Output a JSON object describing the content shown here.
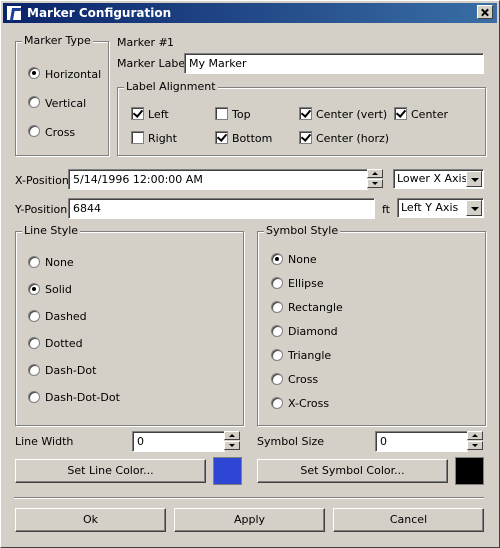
{
  "window": {
    "title": "Marker Configuration"
  },
  "marker_type": {
    "legend": "Marker Type",
    "options": [
      "Horizontal",
      "Vertical",
      "Cross"
    ],
    "selected": "Horizontal"
  },
  "marker": {
    "number_label": "Marker #",
    "number_value": "1",
    "label_caption": "Marker Label",
    "label_value": "My Marker"
  },
  "label_alignment": {
    "legend": "Label Alignment",
    "left": "Left",
    "top": "Top",
    "center_vert": "Center (vert)",
    "center": "Center",
    "right": "Right",
    "bottom": "Bottom",
    "center_horz": "Center (horz)",
    "checked": [
      "Left",
      "Center (vert)",
      "Center",
      "Bottom",
      "Center (horz)"
    ]
  },
  "x_position": {
    "label": "X-Position",
    "value": "5/14/1996 12:00:00 AM",
    "axis": "Lower X Axis"
  },
  "y_position": {
    "label": "Y-Position",
    "value": "6844",
    "unit": "ft",
    "axis": "Left Y Axis"
  },
  "line_style": {
    "legend": "Line Style",
    "options": [
      "None",
      "Solid",
      "Dashed",
      "Dotted",
      "Dash-Dot",
      "Dash-Dot-Dot"
    ],
    "selected": "Solid"
  },
  "symbol_style": {
    "legend": "Symbol Style",
    "options": [
      "None",
      "Ellipse",
      "Rectangle",
      "Diamond",
      "Triangle",
      "Cross",
      "X-Cross"
    ],
    "selected": "None"
  },
  "line_width": {
    "label": "Line Width",
    "value": "0"
  },
  "symbol_size": {
    "label": "Symbol Size",
    "value": "0"
  },
  "buttons": {
    "set_line_color": "Set Line Color...",
    "set_symbol_color": "Set Symbol Color...",
    "ok": "Ok",
    "apply": "Apply",
    "cancel": "Cancel"
  },
  "colors": {
    "line_color": "#2e46d4",
    "symbol_color": "#000000",
    "title_bar": "#0a246a"
  }
}
